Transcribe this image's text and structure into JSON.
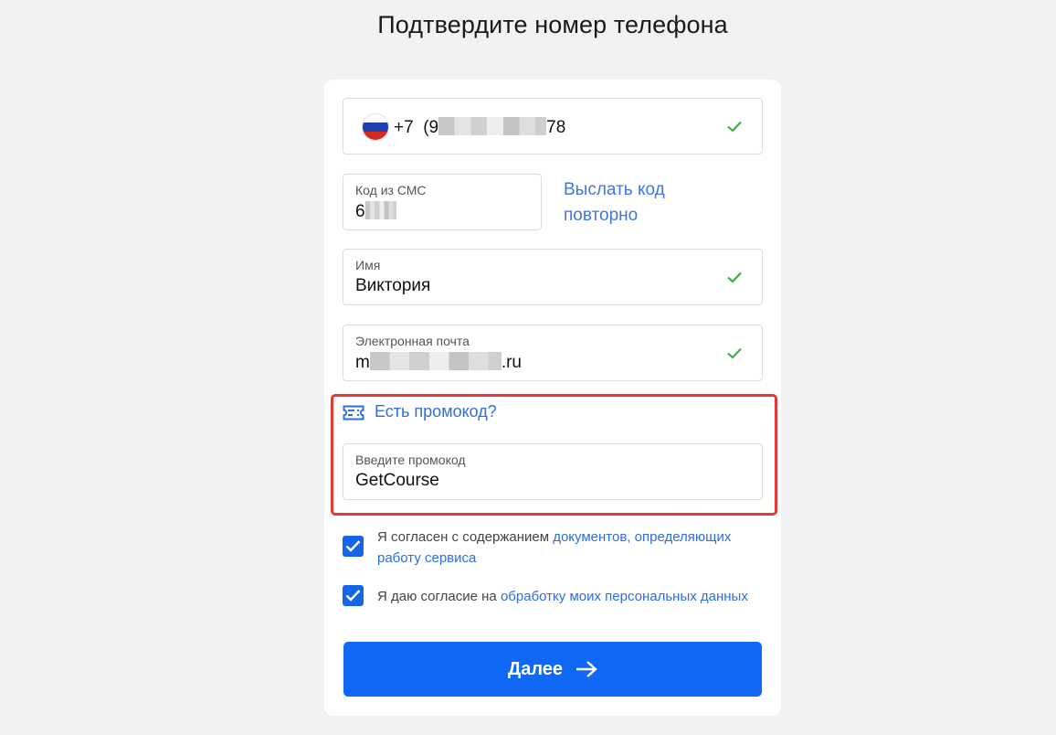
{
  "page": {
    "title": "Подтвердите номер телефона"
  },
  "phone": {
    "country_code": "+7",
    "number_prefix": "(9",
    "number_suffix": "78",
    "country_icon": "russia-flag-icon",
    "status_icon": "checkmark-icon"
  },
  "sms": {
    "label": "Код из СМС",
    "value_prefix": "6",
    "resend_label_line1": "Выслать код",
    "resend_label_line2": "повторно"
  },
  "name": {
    "label": "Имя",
    "value": "Виктория"
  },
  "email": {
    "label": "Электронная почта",
    "value_prefix": "m",
    "value_suffix": ".ru"
  },
  "promo": {
    "link_label": "Есть промокод?",
    "icon": "ticket-icon",
    "label": "Введите промокод",
    "value": "GetCourse"
  },
  "consents": {
    "documents_text": "Я согласен с содержанием ",
    "documents_link": "документов, определяющих работу сервиса",
    "personal_text": "Я даю согласие на ",
    "personal_link": "обработку моих персональных данных"
  },
  "actions": {
    "next_label": "Далее"
  },
  "colors": {
    "accent": "#1168f5",
    "link": "#2d6de6",
    "success": "#3aaa35",
    "highlight_border": "#e53935"
  }
}
